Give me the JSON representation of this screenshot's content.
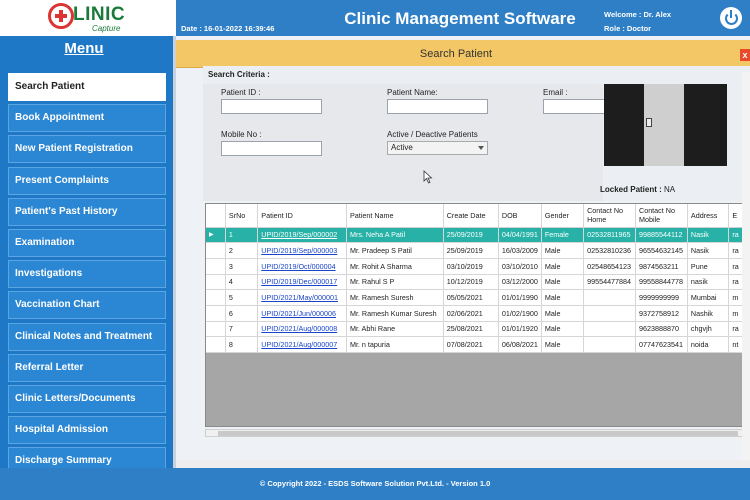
{
  "header": {
    "logo_text": "LINIC",
    "logo_sub": "Capture",
    "date_label": "Date : 16-01-2022 16:39:46",
    "app_title": "Clinic Management Software",
    "welcome": "Welcome : Dr. Alex",
    "role": "Role : Doctor"
  },
  "sidebar": {
    "heading": "Menu",
    "items": [
      {
        "label": "Search Patient"
      },
      {
        "label": "Book Appointment"
      },
      {
        "label": "New Patient Registration"
      },
      {
        "label": "Present Complaints"
      },
      {
        "label": "Patient's Past History"
      },
      {
        "label": "Examination"
      },
      {
        "label": "Investigations"
      },
      {
        "label": "Vaccination Chart"
      },
      {
        "label": "Clinical Notes and Treatment"
      },
      {
        "label": "Referral Letter"
      },
      {
        "label": "Clinic Letters/Documents"
      },
      {
        "label": "Hospital Admission"
      },
      {
        "label": "Discharge Summary"
      }
    ]
  },
  "panel": {
    "title": "Search Patient",
    "close": "x",
    "criteria_label": "Search Criteria :",
    "patient_id_label": "Patient ID :",
    "patient_name_label": "Patient Name:",
    "email_label": "Email :",
    "mobile_label": "Mobile No :",
    "active_label": "Active / Deactive Patients",
    "active_value": "Active",
    "locked_label": "Locked Patient :",
    "locked_value": "NA"
  },
  "grid": {
    "columns": [
      "SrNo",
      "Patient ID",
      "Patient Name",
      "Create Date",
      "DOB",
      "Gender",
      "Contact No Home",
      "Contact No Mobile",
      "Address",
      "E"
    ],
    "rows": [
      [
        "1",
        "UPID/2019/Sep/000002",
        "Mrs. Neha A Patil",
        "25/09/2019",
        "04/04/1991",
        "Female",
        "02532811965",
        "99885544112",
        "Nasik",
        "ra"
      ],
      [
        "2",
        "UPID/2019/Sep/000003",
        "Mr. Pradeep S Patil",
        "25/09/2019",
        "16/03/2009",
        "Male",
        "02532810236",
        "96554632145",
        "Nasik",
        "ra"
      ],
      [
        "3",
        "UPID/2019/Oct/000004",
        "Mr. Rohit A Sharma",
        "03/10/2019",
        "03/10/2010",
        "Male",
        "02548654123",
        "9874563211",
        "Pune",
        "ra"
      ],
      [
        "4",
        "UPID/2019/Dec/000017",
        "Mr. Rahul S P",
        "10/12/2019",
        "03/12/2000",
        "Male",
        "99554477884",
        "99558844778",
        "nasik",
        "ra"
      ],
      [
        "5",
        "UPID/2021/May/000001",
        "Mr. Ramesh  Suresh",
        "05/05/2021",
        "01/01/1990",
        "Male",
        "",
        "9999999999",
        "Mumbai",
        "m"
      ],
      [
        "6",
        "UPID/2021/Jun/000006",
        "Mr. Ramesh Kumar  Suresh",
        "02/06/2021",
        "01/02/1900",
        "Male",
        "",
        "9372758912",
        "Nashik",
        "m"
      ],
      [
        "7",
        "UPID/2021/Aug/000008",
        "Mr. Abhi  Rane",
        "25/08/2021",
        "01/01/1920",
        "Male",
        "",
        "9623888870",
        "chgvjh",
        "ra"
      ],
      [
        "8",
        "UPID/2021/Aug/000007",
        "Mr. n  tapuria",
        "07/08/2021",
        "06/08/2021",
        "Male",
        "",
        "07747623541",
        "noida",
        "nt"
      ]
    ]
  },
  "footer": {
    "copyright": "© Copyright 2022 - ESDS Software Solution Pvt.Ltd. - Version 1.0"
  }
}
